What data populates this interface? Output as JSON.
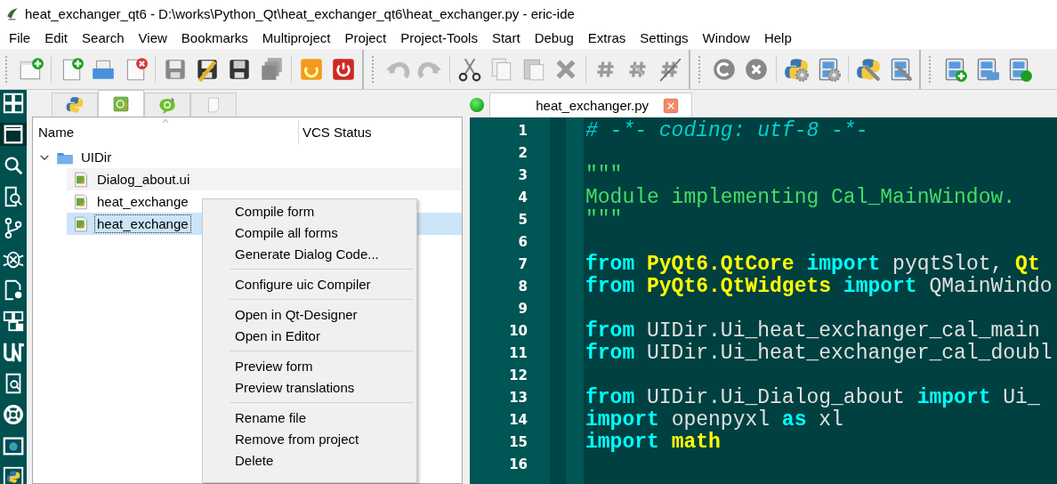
{
  "window": {
    "title": "heat_exchanger_qt6 - D:\\works\\Python_Qt\\heat_exchanger_qt6\\heat_exchanger.py - eric-ide"
  },
  "menu_bar": [
    "File",
    "Edit",
    "Search",
    "View",
    "Bookmarks",
    "Multiproject",
    "Project",
    "Project-Tools",
    "Start",
    "Debug",
    "Extras",
    "Settings",
    "Window",
    "Help"
  ],
  "project_tabs": [
    {
      "kind": "python",
      "selected": false
    },
    {
      "kind": "forms",
      "selected": true
    },
    {
      "kind": "translations",
      "selected": false
    },
    {
      "kind": "others",
      "selected": false
    }
  ],
  "project_tree": {
    "columns": [
      "Name",
      "VCS Status"
    ],
    "items": [
      {
        "label": "UIDir",
        "kind": "folder",
        "expanded": true,
        "selected": false,
        "children": [
          {
            "label": "Dialog_about.ui",
            "kind": "form",
            "selected": false
          },
          {
            "label": "heat_exchange",
            "kind": "form",
            "selected": false
          },
          {
            "label": "heat_exchange",
            "kind": "form",
            "selected": true
          }
        ]
      }
    ]
  },
  "context_menu": {
    "groups": [
      [
        "Compile form",
        "Compile all forms",
        "Generate Dialog Code..."
      ],
      [
        "Configure uic Compiler"
      ],
      [
        "Open in Qt-Designer",
        "Open in Editor"
      ],
      [
        "Preview form",
        "Preview translations"
      ],
      [
        "Rename file",
        "Remove from project",
        "Delete"
      ]
    ]
  },
  "editor": {
    "tabs": [
      {
        "label": "heat_exchanger.py",
        "selected": true
      }
    ],
    "lines": [
      {
        "number": "1",
        "tokens": [
          {
            "kind": "comment",
            "text": "# -*- coding: utf-8 -*-"
          }
        ]
      },
      {
        "number": "2"
      },
      {
        "number": "3",
        "tokens": [
          {
            "kind": "string",
            "text": "\"\"\""
          }
        ]
      },
      {
        "number": "4",
        "tokens": [
          {
            "kind": "string",
            "text": "Module implementing Cal_MainWindow."
          }
        ]
      },
      {
        "number": "5",
        "tokens": [
          {
            "kind": "string",
            "text": "\"\"\""
          }
        ]
      },
      {
        "number": "6"
      },
      {
        "number": "7",
        "tokens": [
          {
            "kind": "keyword",
            "text": "from "
          },
          {
            "kind": "module",
            "text": "PyQt6.QtCore "
          },
          {
            "kind": "keyword",
            "text": "import "
          },
          {
            "kind": "plain",
            "text": "pyqtSlot, "
          },
          {
            "kind": "module",
            "text": "Qt"
          }
        ]
      },
      {
        "number": "8",
        "tokens": [
          {
            "kind": "keyword",
            "text": "from "
          },
          {
            "kind": "module",
            "text": "PyQt6.QtWidgets "
          },
          {
            "kind": "keyword",
            "text": "import "
          },
          {
            "kind": "plain",
            "text": "QMainWindo"
          }
        ]
      },
      {
        "number": "9"
      },
      {
        "number": "10",
        "tokens": [
          {
            "kind": "keyword",
            "text": "from "
          },
          {
            "kind": "plain",
            "text": "UIDir.Ui_heat_exchanger_cal_main"
          }
        ]
      },
      {
        "number": "11",
        "tokens": [
          {
            "kind": "keyword",
            "text": "from "
          },
          {
            "kind": "plain",
            "text": "UIDir.Ui_heat_exchanger_cal_doubl"
          }
        ]
      },
      {
        "number": "12"
      },
      {
        "number": "13",
        "tokens": [
          {
            "kind": "keyword",
            "text": "from "
          },
          {
            "kind": "plain",
            "text": "UIDir.Ui_Dialog_about "
          },
          {
            "kind": "keyword",
            "text": "import "
          },
          {
            "kind": "plain",
            "text": "Ui_"
          }
        ]
      },
      {
        "number": "14",
        "tokens": [
          {
            "kind": "keyword",
            "text": "import "
          },
          {
            "kind": "plain",
            "text": "openpyxl "
          },
          {
            "kind": "keyword",
            "text": "as "
          },
          {
            "kind": "plain",
            "text": "xl"
          }
        ]
      },
      {
        "number": "15",
        "tokens": [
          {
            "kind": "keyword",
            "text": "import "
          },
          {
            "kind": "module",
            "text": "math"
          }
        ]
      },
      {
        "number": "16"
      }
    ]
  }
}
